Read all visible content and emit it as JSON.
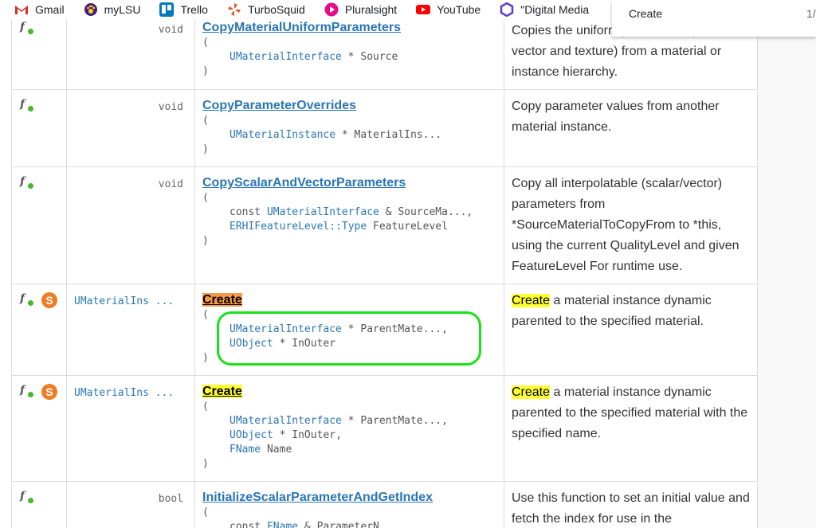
{
  "bookmarks": [
    {
      "label": "Gmail",
      "icon": "gmail-icon",
      "color": "#d93025"
    },
    {
      "label": "myLSU",
      "icon": "paw-icon",
      "color": "#461d7c"
    },
    {
      "label": "Trello",
      "icon": "trello-icon",
      "color": "#0079bf"
    },
    {
      "label": "TurboSquid",
      "icon": "turbosquid-icon",
      "color": "#e05a24"
    },
    {
      "label": "Pluralsight",
      "icon": "pluralsight-icon",
      "color": "#e80a89"
    },
    {
      "label": "YouTube",
      "icon": "youtube-icon",
      "color": "#ff0000"
    },
    {
      "label": "\"Digital Media",
      "icon": "hexagon-icon",
      "color": "#5f3dc4"
    }
  ],
  "find_bar": {
    "query": "Create",
    "count": "1/"
  },
  "rows": [
    {
      "return": "void",
      "name": "CopyMaterialUniformParameters",
      "open": "(",
      "close": ")",
      "params": [
        {
          "type": "UMaterialInterface",
          "rest": " * Source"
        }
      ],
      "desc_hl": "",
      "desc": "Copies the uniform parameters (scalar, vector and texture) from a material or instance hierarchy."
    },
    {
      "return": "void",
      "name": "CopyParameterOverrides",
      "open": "(",
      "close": ")",
      "params": [
        {
          "type": "UMaterialInstance",
          "rest": " * MaterialIns..."
        }
      ],
      "desc_hl": "",
      "desc": "Copy parameter values from another material instance."
    },
    {
      "return": "void",
      "name": "CopyScalarAndVectorParameters",
      "open": "(",
      "close": ")",
      "params": [
        {
          "pre": "const ",
          "type": "UMaterialInterface",
          "rest": " & SourceMa...,"
        },
        {
          "type": "ERHIFeatureLevel::Type",
          "rest": " FeatureLevel"
        }
      ],
      "desc_hl": "",
      "desc": "Copy all interpolatable (scalar/vector) parameters from *SourceMaterialToCopyFrom to *this, using the current QualityLevel and given FeatureLevel For runtime use."
    },
    {
      "return": "UMaterialIns ...",
      "name": "Create",
      "open": "(",
      "close": ")",
      "params": [
        {
          "type": "UMaterialInterface",
          "rest": " * ParentMate...,"
        },
        {
          "type": "UObject",
          "rest": " * InOuter"
        }
      ],
      "desc_hl": "Create",
      "desc": " a material instance dynamic parented to the specified material."
    },
    {
      "return": "UMaterialIns ...",
      "name": "Create",
      "open": "(",
      "close": ")",
      "params": [
        {
          "type": "UMaterialInterface",
          "rest": " * ParentMate...,"
        },
        {
          "type": "UObject",
          "rest": " * InOuter,"
        },
        {
          "type": "FName",
          "rest": " Name"
        }
      ],
      "desc_hl": "Create",
      "desc": " a material instance dynamic parented to the specified material with the specified name."
    },
    {
      "return": "bool",
      "name": "InitializeScalarParameterAndGetIndex",
      "open": "(",
      "close": "",
      "params": [
        {
          "pre": "const ",
          "type": "FName",
          "rest": " & ParameterN..."
        }
      ],
      "desc_hl": "",
      "desc": "Use this function to set an initial value and fetch the index for use in the"
    }
  ],
  "icons": {
    "function": "f",
    "static": "S"
  }
}
